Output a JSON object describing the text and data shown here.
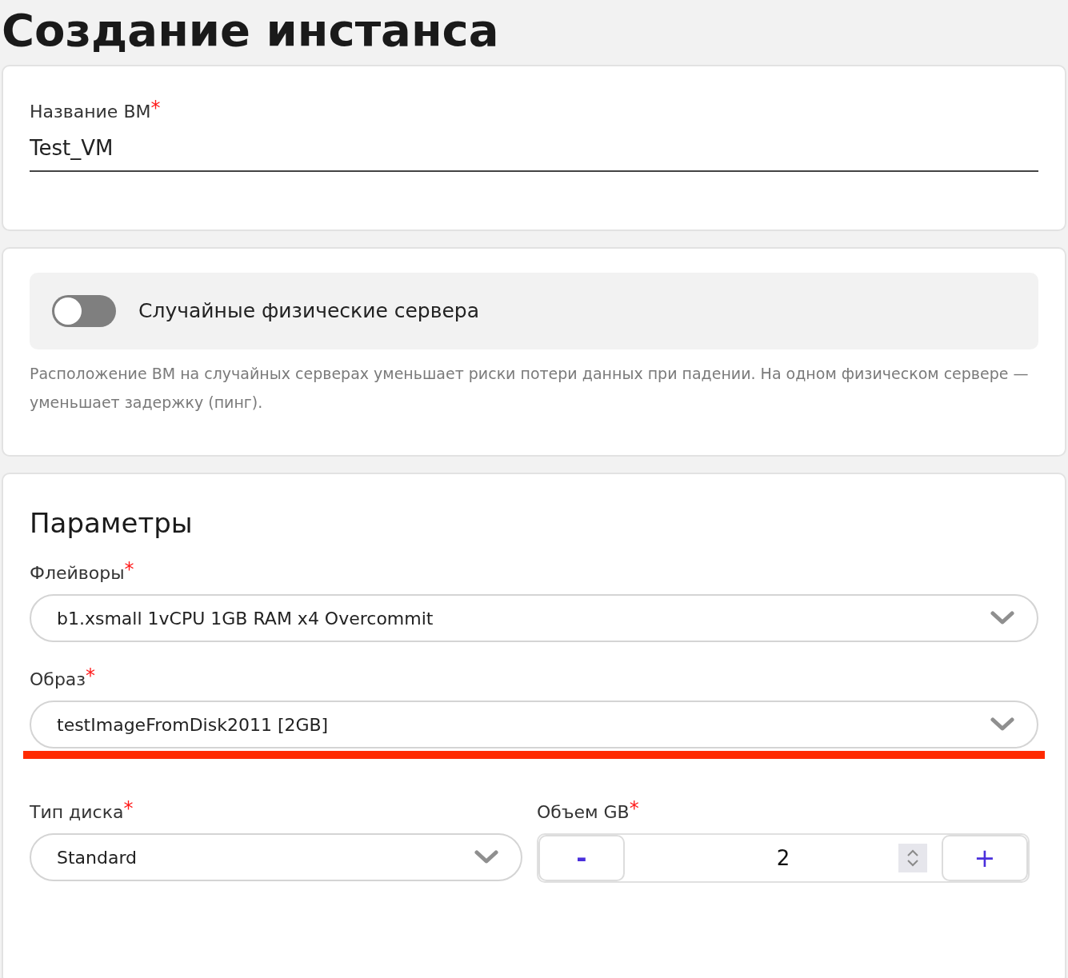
{
  "title": "Создание инстанса",
  "name_card": {
    "label": "Название ВМ",
    "required_mark": "*",
    "value": "Test_VM"
  },
  "placement_card": {
    "toggle": {
      "label": "Случайные физические сервера",
      "on": false
    },
    "description": "Расположение ВМ на случайных серверах уменьшает риски потери данных при падении. На одном физическом сервере — уменьшает задержку (пинг)."
  },
  "params_card": {
    "heading": "Параметры",
    "flavor": {
      "label": "Флейворы",
      "required_mark": "*",
      "value": "b1.xsmall 1vCPU 1GB RAM x4 Overcommit"
    },
    "image": {
      "label": "Образ",
      "required_mark": "*",
      "value": "testImageFromDisk2011 [2GB]",
      "highlighted": true
    },
    "disk_type": {
      "label": "Тип диска",
      "required_mark": "*",
      "value": "Standard"
    },
    "disk_size": {
      "label": "Объем GB",
      "required_mark": "*",
      "value": "2",
      "decrement": "-",
      "increment": "+"
    }
  }
}
